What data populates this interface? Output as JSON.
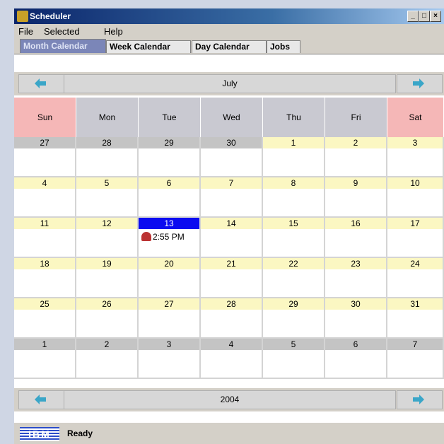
{
  "window": {
    "title": "Scheduler"
  },
  "menu": [
    "File",
    "Selected",
    "Help"
  ],
  "tabs": [
    "Month Calendar",
    "Week Calendar",
    "Day Calendar",
    "Jobs"
  ],
  "active_tab": "Month Calendar",
  "top_nav": {
    "label": "July"
  },
  "bottom_nav": {
    "label": "2004"
  },
  "days": [
    "Sun",
    "Mon",
    "Tue",
    "Wed",
    "Thu",
    "Fri",
    "Sat"
  ],
  "weeks": [
    [
      {
        "d": "27",
        "other": true
      },
      {
        "d": "28",
        "other": true
      },
      {
        "d": "29",
        "other": true
      },
      {
        "d": "30",
        "other": true
      },
      {
        "d": "1"
      },
      {
        "d": "2"
      },
      {
        "d": "3"
      }
    ],
    [
      {
        "d": "4"
      },
      {
        "d": "5"
      },
      {
        "d": "6"
      },
      {
        "d": "7"
      },
      {
        "d": "8"
      },
      {
        "d": "9"
      },
      {
        "d": "10"
      }
    ],
    [
      {
        "d": "11"
      },
      {
        "d": "12"
      },
      {
        "d": "13",
        "selected": true,
        "event": "2:55 PM"
      },
      {
        "d": "14"
      },
      {
        "d": "15"
      },
      {
        "d": "16"
      },
      {
        "d": "17"
      }
    ],
    [
      {
        "d": "18"
      },
      {
        "d": "19"
      },
      {
        "d": "20"
      },
      {
        "d": "21"
      },
      {
        "d": "22"
      },
      {
        "d": "23"
      },
      {
        "d": "24"
      }
    ],
    [
      {
        "d": "25"
      },
      {
        "d": "26"
      },
      {
        "d": "27"
      },
      {
        "d": "28"
      },
      {
        "d": "29"
      },
      {
        "d": "30"
      },
      {
        "d": "31"
      }
    ],
    [
      {
        "d": "1",
        "other": true
      },
      {
        "d": "2",
        "other": true
      },
      {
        "d": "3",
        "other": true
      },
      {
        "d": "4",
        "other": true
      },
      {
        "d": "5",
        "other": true
      },
      {
        "d": "6",
        "other": true
      },
      {
        "d": "7",
        "other": true
      }
    ]
  ],
  "status": {
    "logo": "IBM",
    "text": "Ready"
  },
  "colors": {
    "weekend_header": "#f5b7b7",
    "weekday_header": "#c9c9d1",
    "current_month_day": "#fbf7c2",
    "other_month_day": "#c4c4c4",
    "selected_day": "#0b0bf0",
    "arrow": "#3aa6c8"
  }
}
